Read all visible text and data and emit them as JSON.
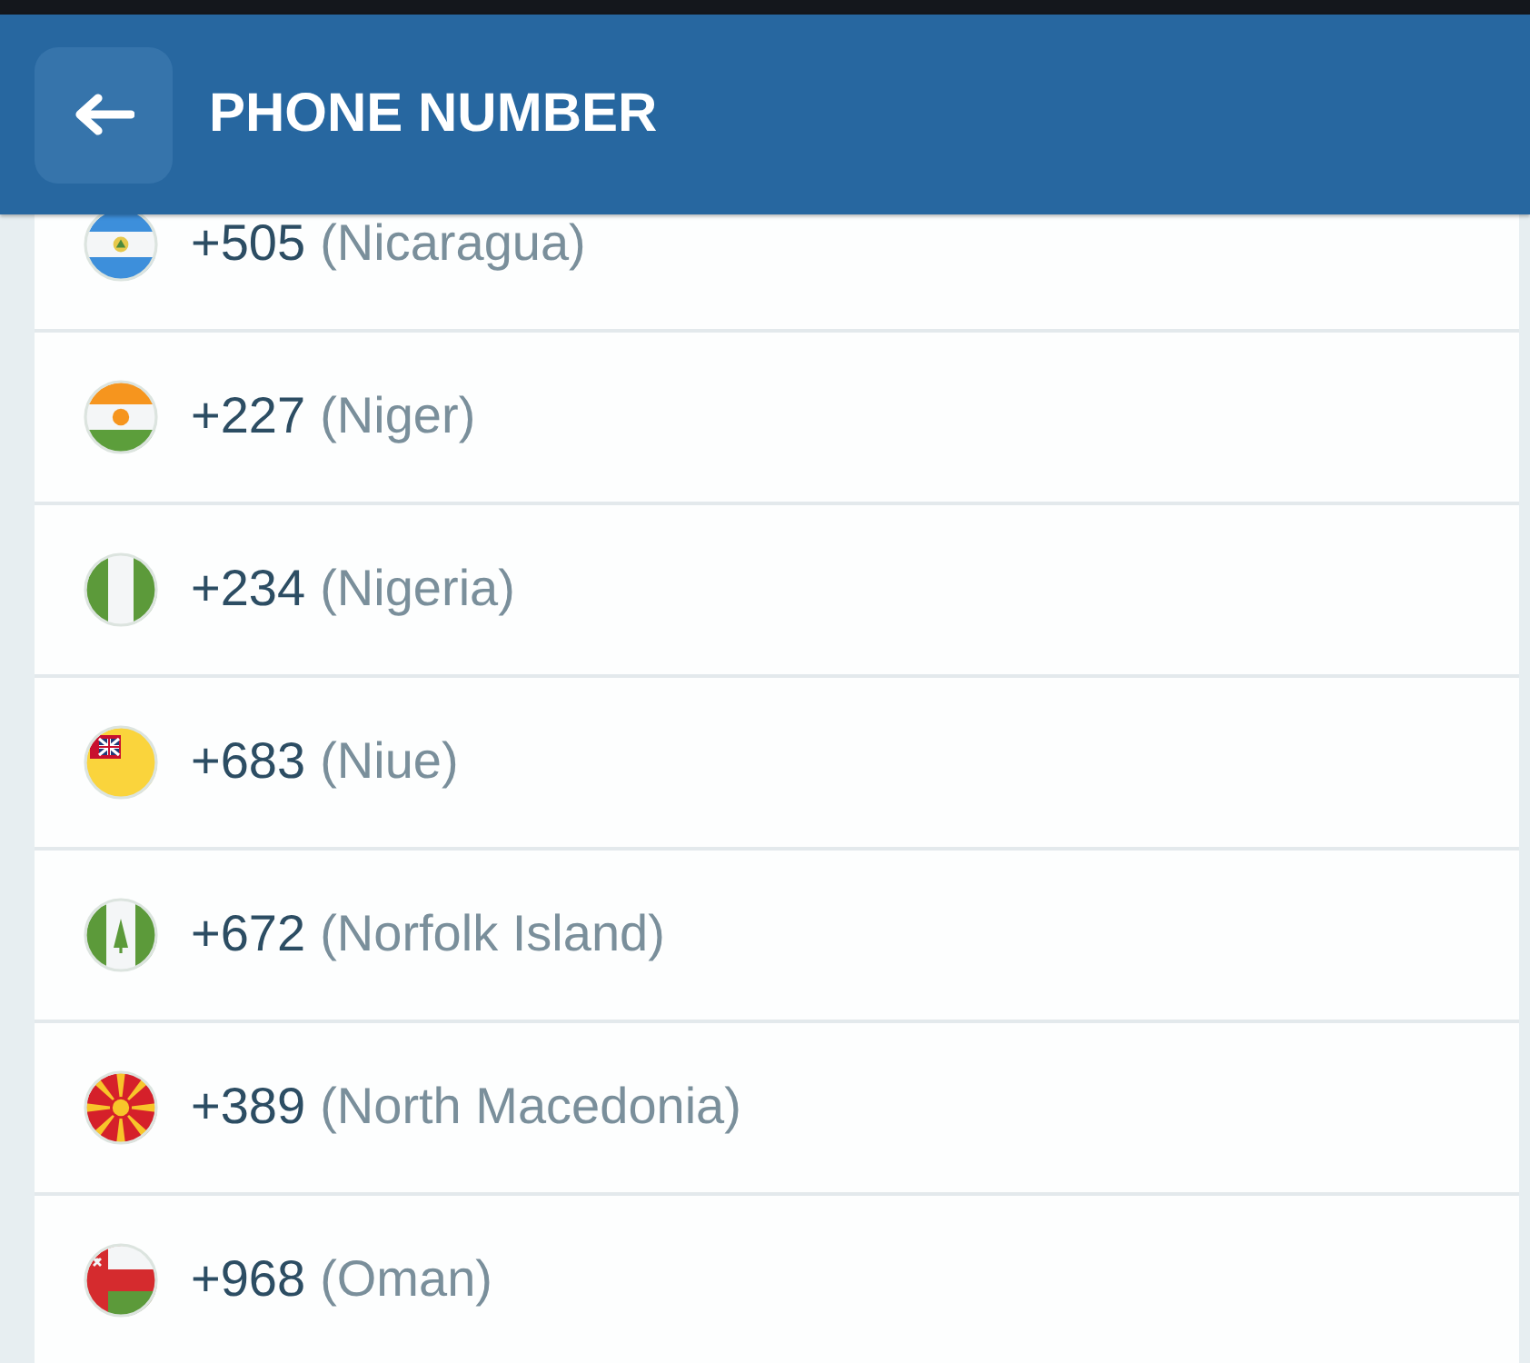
{
  "header": {
    "title": "PHONE NUMBER"
  },
  "countries": [
    {
      "kind": "nicaragua",
      "code": "+505",
      "name": "(Nicaragua)"
    },
    {
      "kind": "niger",
      "code": "+227",
      "name": "(Niger)"
    },
    {
      "kind": "nigeria",
      "code": "+234",
      "name": "(Nigeria)"
    },
    {
      "kind": "niue",
      "code": "+683",
      "name": "(Niue)"
    },
    {
      "kind": "norfolk",
      "code": "+672",
      "name": "(Norfolk Island)"
    },
    {
      "kind": "macedonia",
      "code": "+389",
      "name": "(North Macedonia)"
    },
    {
      "kind": "oman",
      "code": "+968",
      "name": "(Oman)"
    }
  ]
}
